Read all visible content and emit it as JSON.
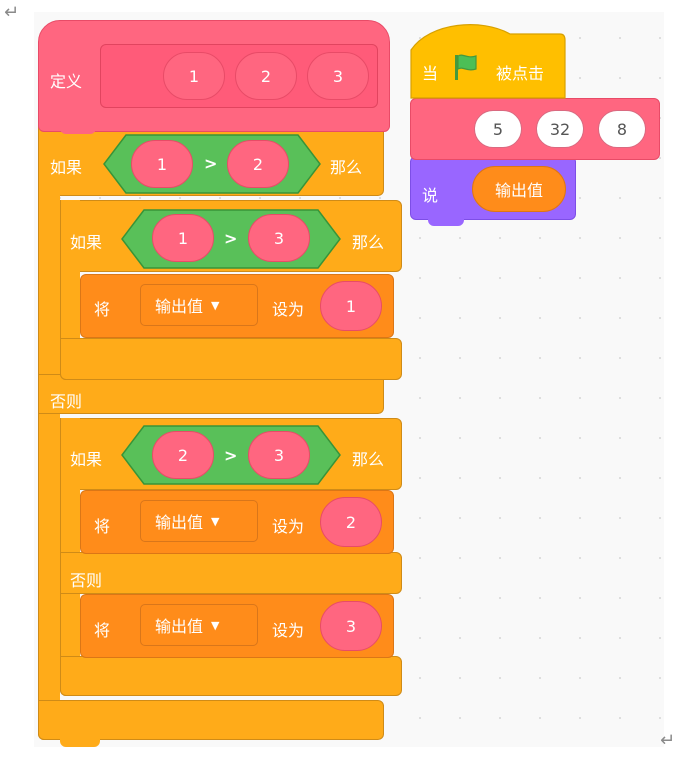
{
  "define_block": {
    "label": "定义",
    "params": [
      "1",
      "2",
      "3"
    ]
  },
  "outer_if": {
    "if_label": "如果",
    "then_label": "那么",
    "else_label": "否则",
    "left": "1",
    "op": ">",
    "right": "2"
  },
  "inner_if_1": {
    "if_label": "如果",
    "then_label": "那么",
    "left": "1",
    "op": ">",
    "right": "3",
    "set": {
      "label": "将",
      "var": "输出值",
      "to_label": "设为",
      "value": "1"
    }
  },
  "inner_if_2": {
    "if_label": "如果",
    "then_label": "那么",
    "else_label": "否则",
    "left": "2",
    "op": ">",
    "right": "3",
    "set_then": {
      "label": "将",
      "var": "输出值",
      "to_label": "设为",
      "value": "2"
    },
    "set_else": {
      "label": "将",
      "var": "输出值",
      "to_label": "设为",
      "value": "3"
    }
  },
  "hat_block": {
    "label_prefix": "当",
    "label_suffix": "被点击",
    "flag_icon": "green-flag-icon"
  },
  "call_block": {
    "args": [
      "5",
      "32",
      "8"
    ]
  },
  "say_block": {
    "label": "说",
    "reporter": "输出值"
  },
  "colors": {
    "control": "#ffab19",
    "custom": "#ff6680",
    "variable": "#ff8c1a",
    "operator": "#59c059",
    "looks": "#9966ff",
    "event": "#ffbf00"
  }
}
